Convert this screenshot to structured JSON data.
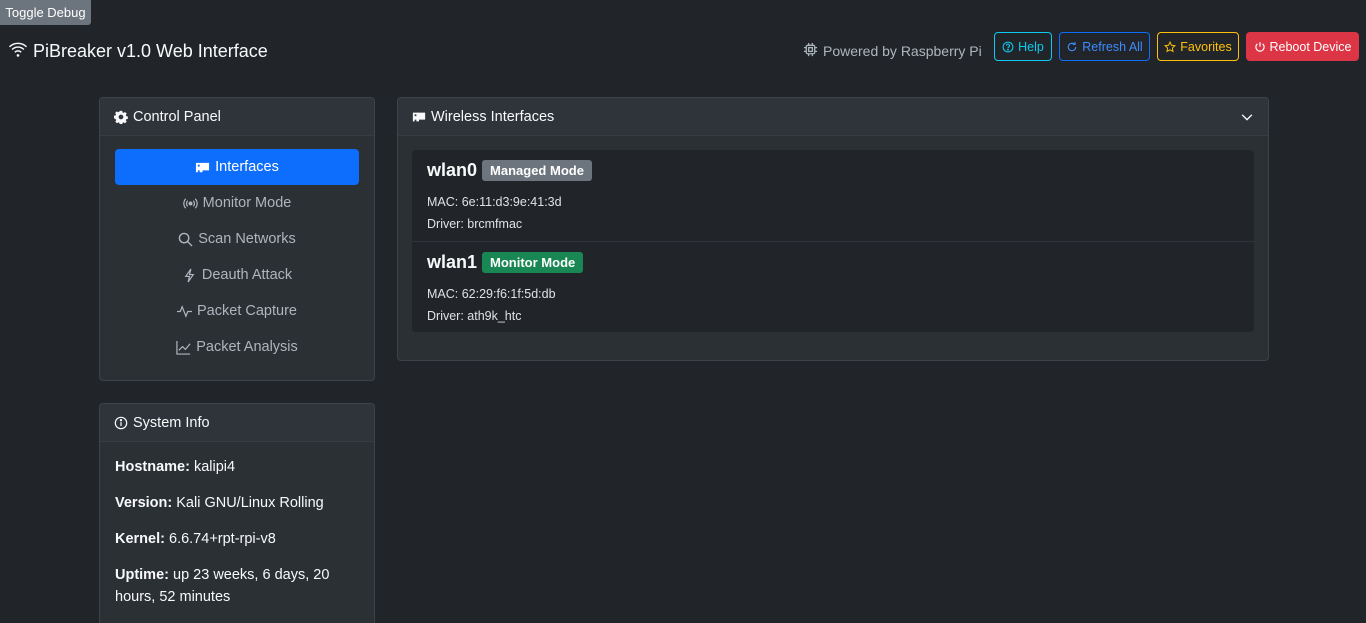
{
  "debug": {
    "label": "Toggle Debug"
  },
  "header": {
    "title": "PiBreaker v1.0 Web Interface",
    "powered_by": "Powered by Raspberry Pi",
    "buttons": {
      "help": "Help",
      "refresh": "Refresh All",
      "favorites": "Favorites",
      "reboot": "Reboot Device"
    }
  },
  "control_panel": {
    "title": "Control Panel",
    "items": [
      {
        "label": "Interfaces",
        "icon": "ethernet-card-icon",
        "active": true
      },
      {
        "label": "Monitor Mode",
        "icon": "broadcast-icon",
        "active": false
      },
      {
        "label": "Scan Networks",
        "icon": "search-icon",
        "active": false
      },
      {
        "label": "Deauth Attack",
        "icon": "lightning-icon",
        "active": false
      },
      {
        "label": "Packet Capture",
        "icon": "activity-icon",
        "active": false
      },
      {
        "label": "Packet Analysis",
        "icon": "graph-icon",
        "active": false
      }
    ]
  },
  "system_info": {
    "title": "System Info",
    "rows": [
      {
        "key": "Hostname:",
        "value": "kalipi4"
      },
      {
        "key": "Version:",
        "value": "Kali GNU/Linux Rolling"
      },
      {
        "key": "Kernel:",
        "value": "6.6.74+rpt-rpi-v8"
      },
      {
        "key": "Uptime:",
        "value": "up 23 weeks, 6 days, 20 hours, 52 minutes"
      }
    ]
  },
  "wireless": {
    "title": "Wireless Interfaces",
    "interfaces": [
      {
        "name": "wlan0",
        "mode": "Managed Mode",
        "mac": "MAC: 6e:11:d3:9e:41:3d",
        "driver": "Driver: brcmfmac"
      },
      {
        "name": "wlan1",
        "mode": "Monitor Mode",
        "mac": "MAC: 62:29:f6:1f:5d:db",
        "driver": "Driver: ath9k_htc"
      }
    ]
  },
  "colors": {
    "background": "#212529",
    "primary": "#0d6efd",
    "success": "#198754",
    "danger": "#dc3545",
    "warning": "#ffc107",
    "info": "#0dcaf0",
    "secondary": "#6c757d"
  }
}
